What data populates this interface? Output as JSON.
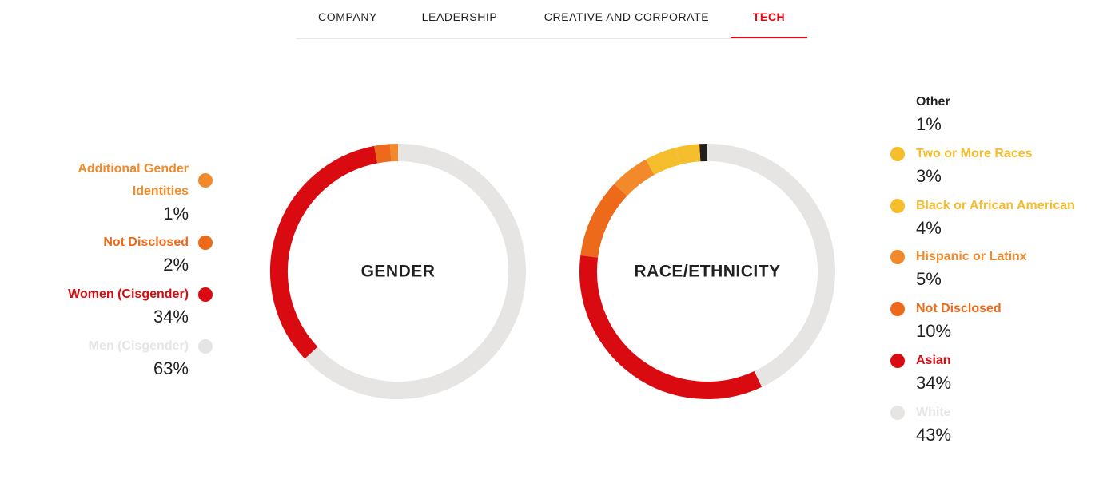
{
  "tabs": [
    {
      "label": "COMPANY",
      "active": false
    },
    {
      "label": "LEADERSHIP",
      "active": false
    },
    {
      "label": "CREATIVE AND CORPORATE",
      "active": false
    },
    {
      "label": "TECH",
      "active": true
    }
  ],
  "colors": {
    "accent": "#e50914",
    "red": "#d90a10",
    "orange_dark": "#ec6a19",
    "orange_mid": "#f28a2b",
    "orange_light": "#f6a23a",
    "yellow": "#f6bd2d",
    "grey": "#e6e5e3"
  },
  "chart_data": [
    {
      "type": "pie",
      "title": "GENDER",
      "categories": [
        "Additional Gender Identities",
        "Not Disclosed",
        "Women (Cisgender)",
        "Men (Cisgender)"
      ],
      "values": [
        1,
        2,
        34,
        63
      ],
      "value_labels": [
        "1%",
        "2%",
        "34%",
        "63%"
      ],
      "colors": [
        "#f28a2b",
        "#ec6a19",
        "#d90a10",
        "#e6e5e3"
      ],
      "legend_placement": "left"
    },
    {
      "type": "pie",
      "title": "RACE/ETHNICITY",
      "categories": [
        "Other",
        "Two or More Races",
        "Black or African American",
        "Hispanic or Latinx",
        "Not Disclosed",
        "Asian",
        "White"
      ],
      "values": [
        1,
        3,
        4,
        5,
        10,
        34,
        43
      ],
      "value_labels": [
        "1%",
        "3%",
        "4%",
        "5%",
        "10%",
        "34%",
        "43%"
      ],
      "colors": [
        "#221f1f",
        "#f6bd2d",
        "#f6bd2d",
        "#f28a2b",
        "#ec6a19",
        "#d90a10",
        "#e6e5e3"
      ],
      "legend_placement": "right"
    }
  ]
}
